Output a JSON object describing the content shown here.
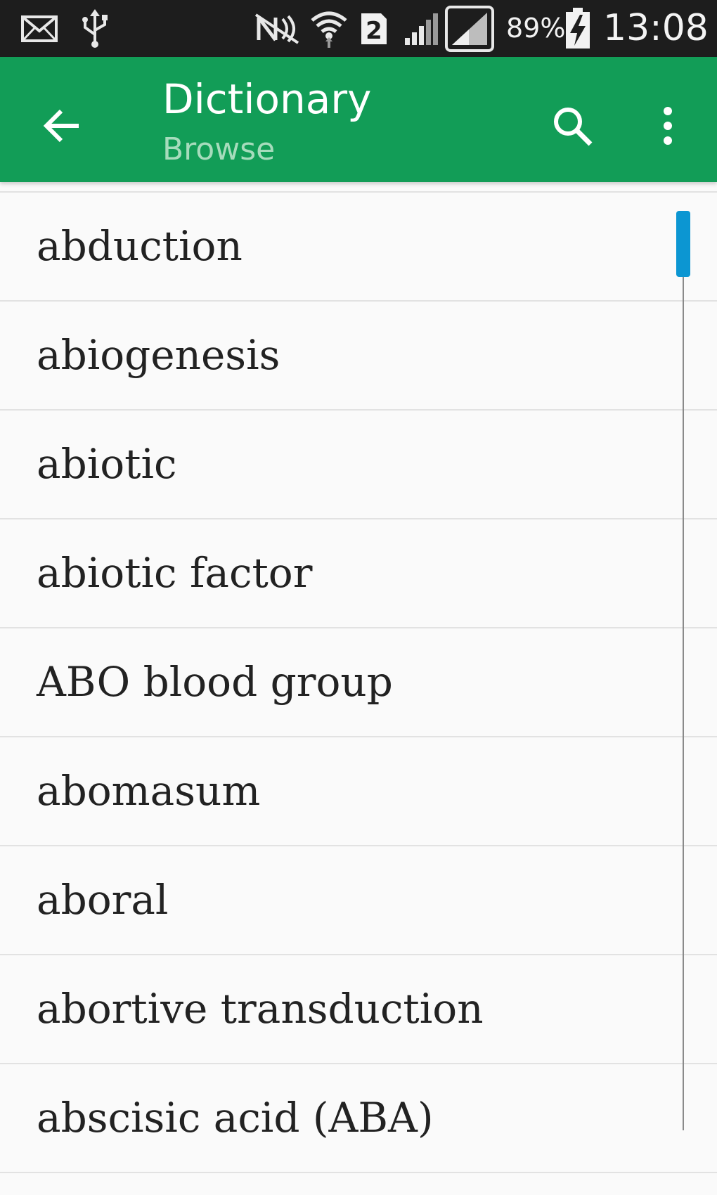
{
  "status_bar": {
    "icons": [
      "mail-icon",
      "usb-icon",
      "nfc-off-icon",
      "wifi-icon",
      "sim-2-icon",
      "signal-icon",
      "signal-full-icon",
      "battery-charging-icon"
    ],
    "sim_slot": "2",
    "battery_percent": "89%",
    "time": "13:08"
  },
  "app_bar": {
    "title": "Dictionary",
    "subtitle": "Browse",
    "color": "#129d57",
    "icons": [
      "arrow-left-icon",
      "search-icon",
      "more-vert-icon"
    ]
  },
  "list": {
    "items": [
      {
        "label": "abduction"
      },
      {
        "label": "abiogenesis"
      },
      {
        "label": "abiotic"
      },
      {
        "label": "abiotic factor"
      },
      {
        "label": "ABO blood group"
      },
      {
        "label": "abomasum"
      },
      {
        "label": "aboral"
      },
      {
        "label": "abortive transduction"
      },
      {
        "label": "abscisic acid (ABA)"
      }
    ]
  },
  "scrollbar": {
    "position_fraction": 0.0,
    "thumb_color": "#0c96d2"
  }
}
